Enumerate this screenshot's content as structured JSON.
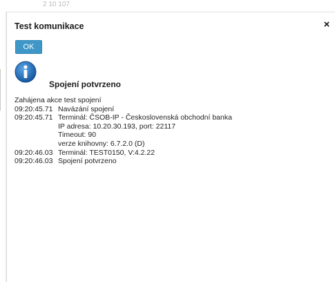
{
  "background": {
    "fragment_top": "2 10 107"
  },
  "dialog": {
    "title": "Test komunikace",
    "close_glyph": "×",
    "ok_label": "OK",
    "status_icon": "info-icon",
    "status_text": "Spojení potvrzeno",
    "log": [
      {
        "time": "",
        "text": "Zahájena akce test spojení"
      },
      {
        "time": "09:20:45.71",
        "text": "Navázání spojení"
      },
      {
        "time": "09:20:45.71",
        "text": "Terminál: ČSOB-IP - Československá obchodní banka"
      },
      {
        "time": "",
        "text": "IP adresa: 10.20.30.193, port: 22117"
      },
      {
        "time": "",
        "text": "Timeout: 90"
      },
      {
        "time": "",
        "text": "verze knihovny: 6.7.2.0 (D)"
      },
      {
        "time": "09:20:46.03",
        "text": "Terminál: TEST0150, V:4.2.22"
      },
      {
        "time": "09:20:46.03",
        "text": "Spojení potvrzeno"
      }
    ]
  },
  "colors": {
    "ok_button": "#3f97c8",
    "info_icon": "#1e6fb3"
  }
}
